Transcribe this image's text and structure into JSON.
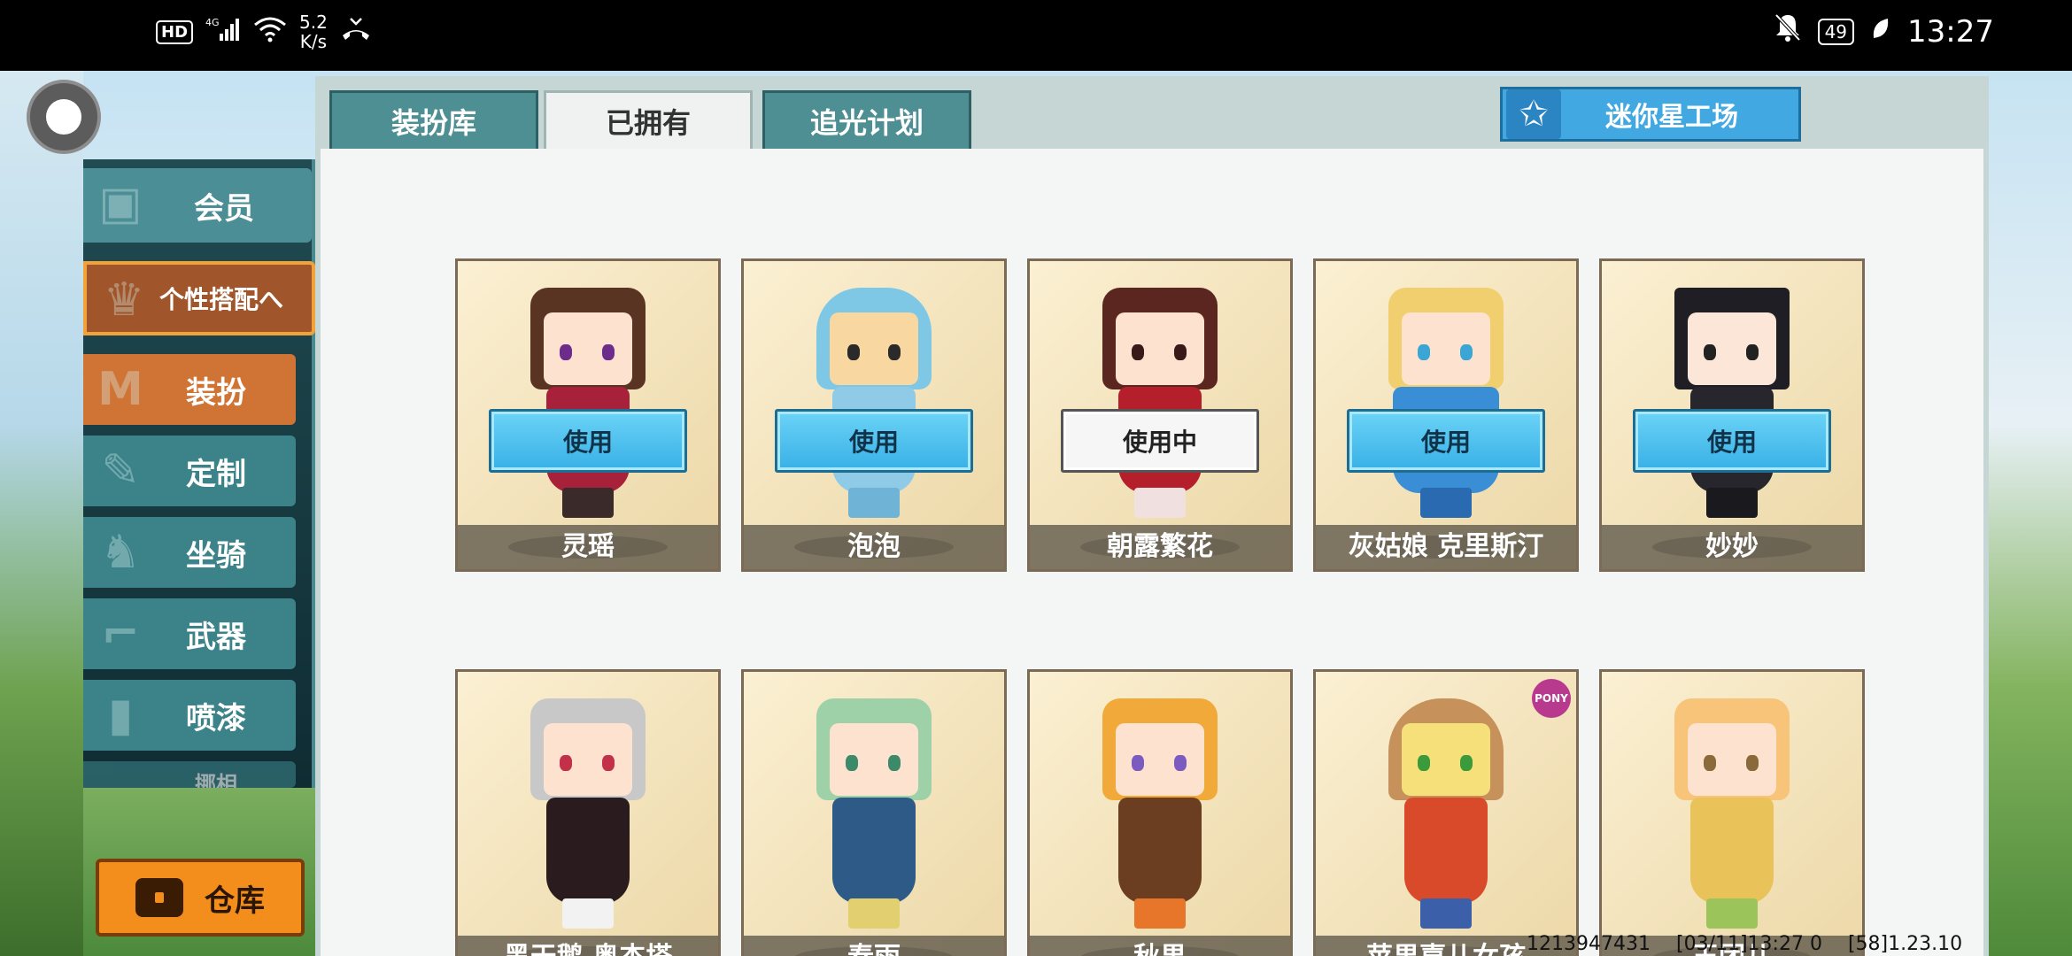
{
  "status_bar": {
    "hd": "HD",
    "network": "4G",
    "speed_value": "5.2",
    "speed_unit": "K/s",
    "battery": "49",
    "time": "13:27"
  },
  "tabs": [
    {
      "label": "装扮库",
      "active": false
    },
    {
      "label": "已拥有",
      "active": true
    },
    {
      "label": "追光计划",
      "active": false
    }
  ],
  "star_workshop": {
    "label": "迷你星工场",
    "icon": "star-icon"
  },
  "sidebar": {
    "items": [
      {
        "label": "会员",
        "icon": "member-icon"
      },
      {
        "label": "个性搭配へ",
        "icon": "trophy-icon"
      },
      {
        "label": "装扮",
        "icon": "shirt-icon"
      },
      {
        "label": "定制",
        "icon": "pencil-icon"
      },
      {
        "label": "坐骑",
        "icon": "mount-icon"
      },
      {
        "label": "武器",
        "icon": "gun-icon"
      },
      {
        "label": "喷漆",
        "icon": "spray-icon"
      },
      {
        "label": "挪相",
        "icon": "frame-icon"
      }
    ],
    "warehouse": "仓库"
  },
  "cards": [
    {
      "name": "灵瑶",
      "button": "使用",
      "in_use": false
    },
    {
      "name": "泡泡",
      "button": "使用",
      "in_use": false
    },
    {
      "name": "朝露繁花",
      "button": "使用中",
      "in_use": true
    },
    {
      "name": "灰姑娘 克里斯汀",
      "button": "使用",
      "in_use": false
    },
    {
      "name": "妙妙",
      "button": "使用",
      "in_use": false
    },
    {
      "name": "黑天鹅 奥杰塔"
    },
    {
      "name": "春雨"
    },
    {
      "name": "秋果"
    },
    {
      "name": "苹果嘉儿女孩",
      "badge": "PONY"
    },
    {
      "name": "玉团儿"
    }
  ],
  "footer": {
    "uid": "1213947431",
    "timestamp": "[03/11]13:27 0",
    "version": "[58]1.23.10"
  }
}
